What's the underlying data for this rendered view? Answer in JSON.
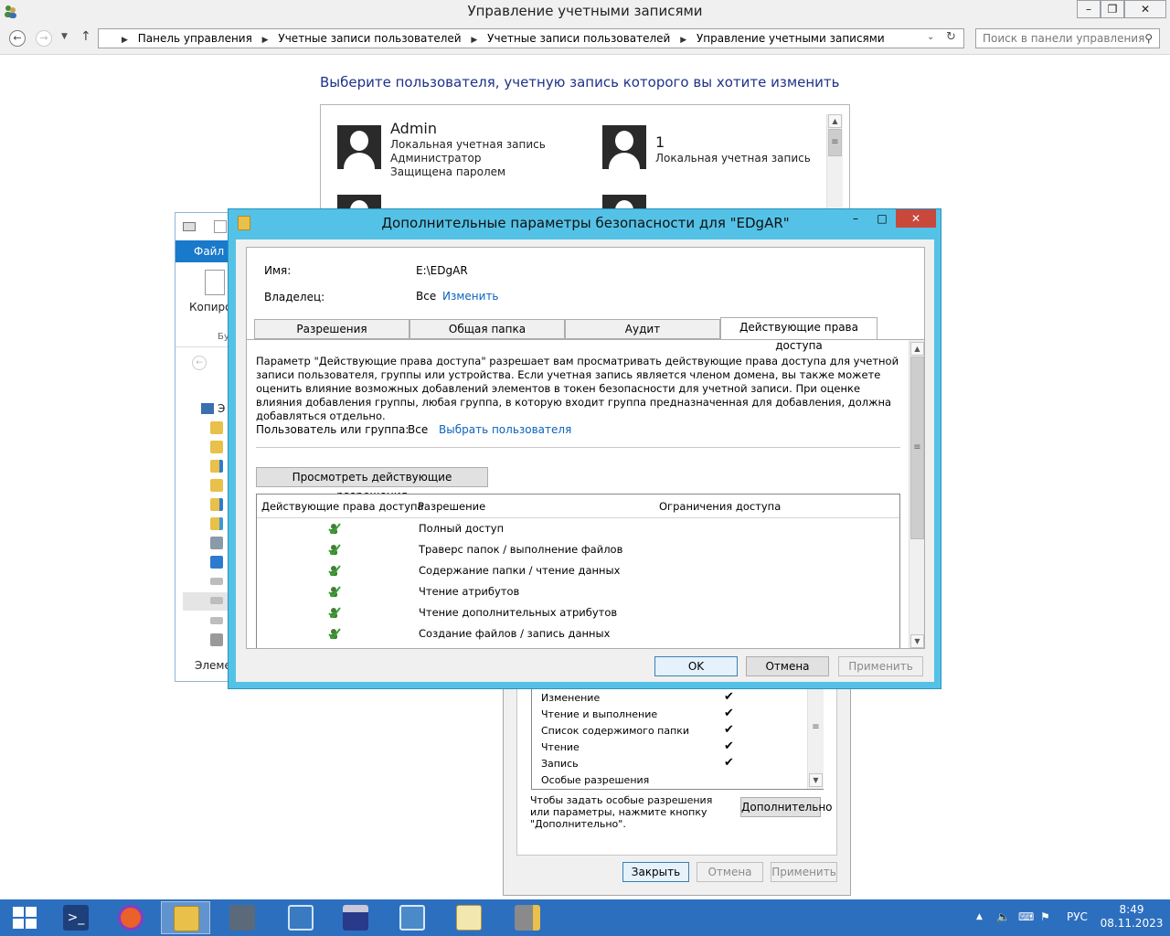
{
  "control_panel": {
    "window_title": "Управление учетными записями",
    "breadcrumbs": [
      "Панель управления",
      "Учетные записи пользователей",
      "Учетные записи пользователей",
      "Управление учетными записями"
    ],
    "search_placeholder": "Поиск в панели управления",
    "heading": "Выберите пользователя, учетную запись которого вы хотите изменить",
    "accounts": [
      {
        "name": "Admin",
        "lines": [
          "Локальная учетная запись",
          "Администратор",
          "Защищена паролем"
        ]
      },
      {
        "name": "1",
        "lines": [
          "Локальная учетная запись"
        ]
      }
    ]
  },
  "explorer": {
    "ribbon_file_tab": "Файл",
    "copy_label": "Копиро",
    "clipboard_label": "Буф",
    "tree_label": "Э",
    "status_label": "Элеме"
  },
  "properties_dialog": {
    "permissions": [
      {
        "name": "Изменение",
        "allow": "✔"
      },
      {
        "name": "Чтение и выполнение",
        "allow": "✔"
      },
      {
        "name": "Список содержимого папки",
        "allow": "✔"
      },
      {
        "name": "Чтение",
        "allow": "✔"
      },
      {
        "name": "Запись",
        "allow": "✔"
      },
      {
        "name": "Особые разрешения",
        "allow": ""
      }
    ],
    "hint": "Чтобы задать особые разрешения или параметры, нажмите кнопку \"Дополнительно\".",
    "advanced_button": "Дополнительно",
    "close_button": "Закрыть",
    "cancel_button": "Отмена",
    "apply_button": "Применить"
  },
  "advanced_dialog": {
    "title": "Дополнительные параметры безопасности  для \"EDgAR\"",
    "name_label": "Имя:",
    "name_value": "E:\\EDgAR",
    "owner_label": "Владелец:",
    "owner_value": "Все",
    "owner_change_link": "Изменить",
    "tabs": [
      {
        "label": "Разрешения",
        "active": false
      },
      {
        "label": "Общая папка",
        "active": false
      },
      {
        "label": "Аудит",
        "active": false
      },
      {
        "label": "Действующие права доступа",
        "active": true
      }
    ],
    "description": "Параметр \"Действующие права доступа\" разрешает вам просматривать действующие права доступа для учетной записи пользователя, группы или устройства. Если учетная запись является членом домена, вы также можете оценить влияние возможных добавлений элементов в токен безопасности для учетной записи. При оценке влияния добавления группы, любая группа, в которую входит группа предназначенная для добавления, должна добавляться отдельно.",
    "user_group_label": "Пользователь или группа:",
    "user_group_value": "Все",
    "select_user_link": "Выбрать пользователя",
    "view_button": "Просмотреть действующие разрешения",
    "table_headers": [
      "Действующие права доступа",
      "Разрешение",
      "Ограничения доступа"
    ],
    "table_rows": [
      "Полный доступ",
      "Траверс папок / выполнение файлов",
      "Содержание папки / чтение данных",
      "Чтение атрибутов",
      "Чтение дополнительных атрибутов",
      "Создание файлов / запись данных"
    ],
    "ok_button": "OK",
    "cancel_button": "Отмена",
    "apply_button": "Применить"
  },
  "taskbar": {
    "items": [
      "windows-start",
      "powershell",
      "firefox",
      "file-explorer",
      "server-manager",
      "network",
      "floppy-save",
      "control-panel",
      "notepad",
      "server-lock"
    ],
    "language": "РУС",
    "time": "8:49",
    "date": "08.11.2023"
  }
}
